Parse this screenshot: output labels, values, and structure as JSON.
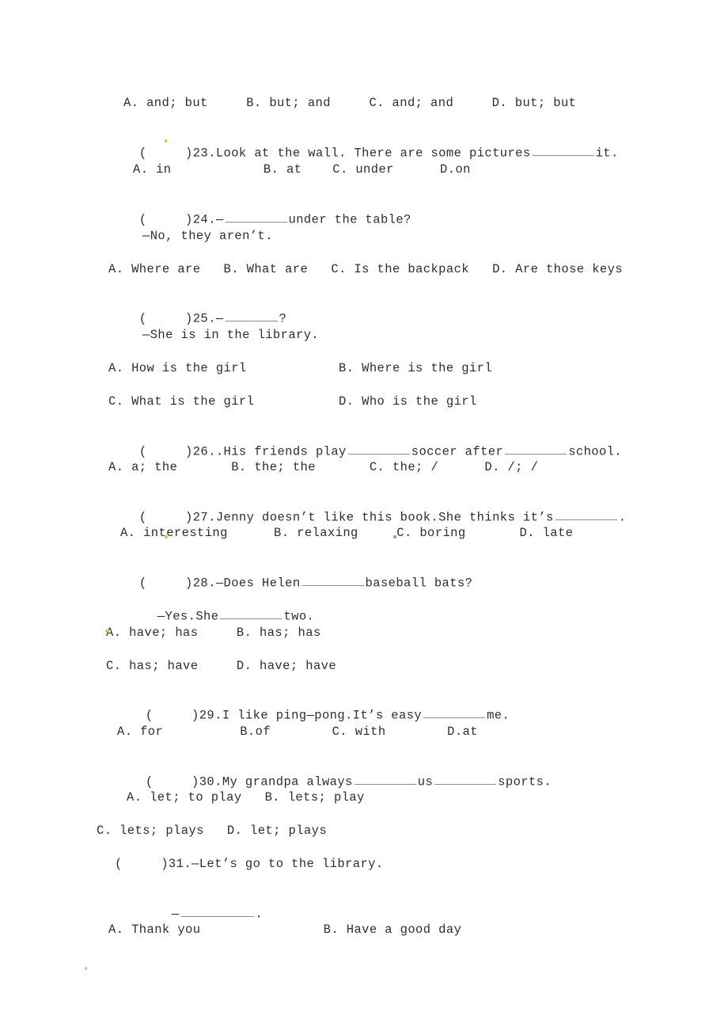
{
  "document": {
    "type": "english-grammar-worksheet",
    "background_color": "#ffffff",
    "text_color": "#2e2e2e",
    "blank_rule_color": "#8c8c8c"
  },
  "lines": [
    {
      "id": "l01",
      "text": "A. and; but     B. but; and     C. and; and     D. but; but"
    },
    {
      "id": "l02a",
      "text": "(     )23."
    },
    {
      "id": "l02b",
      "text": "Look at the wall. There are some pictures"
    },
    {
      "id": "l02c",
      "text": "it."
    },
    {
      "id": "l03",
      "text": "A. in            B. at    C. under      D.on"
    },
    {
      "id": "l04a",
      "text": "(     )24.—"
    },
    {
      "id": "l04b",
      "text": "under the table?"
    },
    {
      "id": "l05",
      "text": "—No, they aren’t."
    },
    {
      "id": "l06",
      "text": "A. Where are   B. What are   C. Is the backpack   D. Are those keys"
    },
    {
      "id": "l07a",
      "text": "(     )25.—"
    },
    {
      "id": "l07b",
      "text": "?"
    },
    {
      "id": "l08",
      "text": "—She is in the library."
    },
    {
      "id": "l09",
      "text": "A. How is the girl            B. Where is the girl"
    },
    {
      "id": "l10",
      "text": "C. What is the girl           D. Who is the girl"
    },
    {
      "id": "l11a",
      "text": "(     )26..His friends play"
    },
    {
      "id": "l11b",
      "text": "soccer after"
    },
    {
      "id": "l11c",
      "text": "school."
    },
    {
      "id": "l12",
      "text": "A. a; the       B. the; the       C. the; /      D. /; /"
    },
    {
      "id": "l13a",
      "text": "(     )27.Jenny doesn’t like this book.She thinks it’s"
    },
    {
      "id": "l13b",
      "text": "."
    },
    {
      "id": "l14",
      "text": "A. interesting      B. relaxing     C. boring       D. late"
    },
    {
      "id": "l15a",
      "text": "(     )28.—Does Helen"
    },
    {
      "id": "l15b",
      "text": "baseball bats?"
    },
    {
      "id": "l16a",
      "text": "—Yes.She"
    },
    {
      "id": "l16b",
      "text": "two."
    },
    {
      "id": "l17",
      "text": "A. have; has     B. has; has"
    },
    {
      "id": "l18",
      "text": "C. has; have     D. have; have"
    },
    {
      "id": "l19a",
      "text": "(     )29.I like ping—pong.It’s easy"
    },
    {
      "id": "l19b",
      "text": "me."
    },
    {
      "id": "l20",
      "text": "A. for          B.of        C. with        D.at"
    },
    {
      "id": "l21a",
      "text": "(     )30.My grandpa always"
    },
    {
      "id": "l21b",
      "text": "us"
    },
    {
      "id": "l21c",
      "text": "sports."
    },
    {
      "id": "l22",
      "text": "A. let; to play   B. lets; play"
    },
    {
      "id": "l23",
      "text": "C. lets; plays   D. let; plays"
    },
    {
      "id": "l24",
      "text": "(     )31.—Let’s go to the library."
    },
    {
      "id": "l25a",
      "text": "—"
    },
    {
      "id": "l25b",
      "text": "."
    },
    {
      "id": "l26",
      "text": "A. Thank you                B. Have a good day"
    }
  ],
  "questions": [
    {
      "number": "23",
      "stem": "Look at the wall. There are some pictures ________ it.",
      "options": [
        "A. in",
        "B. at",
        "C. under",
        "D.on"
      ]
    },
    {
      "number": "24",
      "stem": "—________under the table?",
      "reply": "—No, they aren’t.",
      "options": [
        "A. Where are",
        "B. What are",
        "C. Is the backpack",
        "D. Are those keys"
      ]
    },
    {
      "number": "25",
      "stem": "—________?",
      "reply": "—She is in the library.",
      "options": [
        "A. How is the girl",
        "B. Where is the girl",
        "C. What is the girl",
        "D. Who is the girl"
      ]
    },
    {
      "number": "26",
      "stem": ".His friends play ________ soccer after ________ school.",
      "options": [
        "A. a; the",
        "B. the; the",
        "C. the; /",
        "D. /; /"
      ]
    },
    {
      "number": "27",
      "stem": "Jenny doesn’t like this book.She thinks it’s ________.",
      "options": [
        "A. interesting",
        "B. relaxing",
        "C. boring",
        "D. late"
      ]
    },
    {
      "number": "28",
      "stem": "—Does Helen ________ baseball bats?",
      "reply": "—Yes.She ________ two.",
      "options": [
        "A. have; has",
        "B. has; has",
        "C. has; have",
        "D. have; have"
      ]
    },
    {
      "number": "29",
      "stem": "I like ping—pong.It’s easy ________ me.",
      "options": [
        "A. for",
        "B.of",
        "C. with",
        "D.at"
      ]
    },
    {
      "number": "30",
      "stem": "My grandpa always ________ us ________ sports.",
      "options": [
        "A. let; to play",
        "B. lets; play",
        "C. lets; plays",
        "D. let; plays"
      ]
    },
    {
      "number": "31",
      "stem": "—Let’s go to the library.",
      "reply": "—________.",
      "options": [
        "A. Thank you",
        "B. Have a good day"
      ]
    }
  ],
  "previous_question_options": {
    "note": "trailing option row of question 22 at top of page",
    "options": [
      "A. and; but",
      "B. but; and",
      "C. and; and",
      "D. but; but"
    ]
  }
}
